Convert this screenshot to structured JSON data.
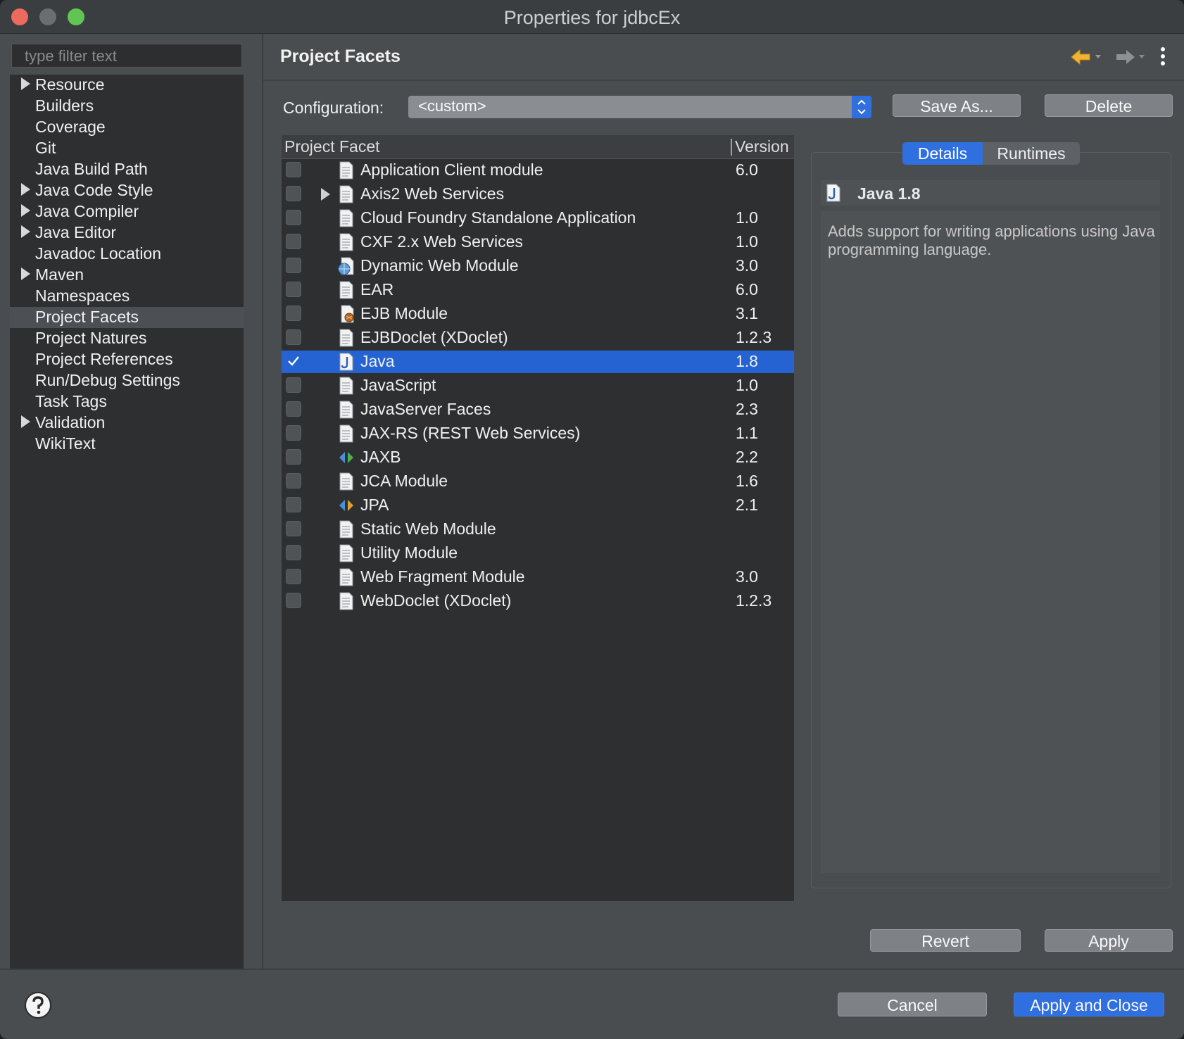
{
  "window": {
    "title": "Properties for jdbcEx"
  },
  "filter": {
    "placeholder": "type filter text"
  },
  "nav": {
    "items": [
      {
        "label": "Resource",
        "expandable": true
      },
      {
        "label": "Builders",
        "expandable": false
      },
      {
        "label": "Coverage",
        "expandable": false
      },
      {
        "label": "Git",
        "expandable": false
      },
      {
        "label": "Java Build Path",
        "expandable": false
      },
      {
        "label": "Java Code Style",
        "expandable": true
      },
      {
        "label": "Java Compiler",
        "expandable": true
      },
      {
        "label": "Java Editor",
        "expandable": true
      },
      {
        "label": "Javadoc Location",
        "expandable": false
      },
      {
        "label": "Maven",
        "expandable": true
      },
      {
        "label": "Namespaces",
        "expandable": false
      },
      {
        "label": "Project Facets",
        "expandable": false,
        "selected": true
      },
      {
        "label": "Project Natures",
        "expandable": false
      },
      {
        "label": "Project References",
        "expandable": false
      },
      {
        "label": "Run/Debug Settings",
        "expandable": false
      },
      {
        "label": "Task Tags",
        "expandable": false
      },
      {
        "label": "Validation",
        "expandable": true
      },
      {
        "label": "WikiText",
        "expandable": false
      }
    ]
  },
  "page": {
    "title": "Project Facets"
  },
  "config": {
    "label": "Configuration:",
    "value": "<custom>",
    "save_as": "Save As...",
    "delete": "Delete"
  },
  "facets": {
    "col_facet": "Project Facet",
    "col_version": "Version",
    "rows": [
      {
        "name": "Application Client module",
        "version": "6.0",
        "checked": false,
        "icon": "document-icon"
      },
      {
        "name": "Axis2 Web Services",
        "version": "",
        "checked": false,
        "icon": "document-icon",
        "expandable": true
      },
      {
        "name": "Cloud Foundry Standalone Application",
        "version": "1.0",
        "checked": false,
        "icon": "document-icon"
      },
      {
        "name": "CXF 2.x Web Services",
        "version": "1.0",
        "checked": false,
        "icon": "document-icon"
      },
      {
        "name": "Dynamic Web Module",
        "version": "3.0",
        "checked": false,
        "icon": "web-module-icon"
      },
      {
        "name": "EAR",
        "version": "6.0",
        "checked": false,
        "icon": "document-icon"
      },
      {
        "name": "EJB Module",
        "version": "3.1",
        "checked": false,
        "icon": "ejb-icon"
      },
      {
        "name": "EJBDoclet (XDoclet)",
        "version": "1.2.3",
        "checked": false,
        "icon": "document-icon"
      },
      {
        "name": "Java",
        "version": "1.8",
        "checked": true,
        "selected": true,
        "icon": "java-icon"
      },
      {
        "name": "JavaScript",
        "version": "1.0",
        "checked": false,
        "icon": "document-icon"
      },
      {
        "name": "JavaServer Faces",
        "version": "2.3",
        "checked": false,
        "icon": "document-icon"
      },
      {
        "name": "JAX-RS (REST Web Services)",
        "version": "1.1",
        "checked": false,
        "icon": "document-icon"
      },
      {
        "name": "JAXB",
        "version": "2.2",
        "checked": false,
        "icon": "jaxb-icon"
      },
      {
        "name": "JCA Module",
        "version": "1.6",
        "checked": false,
        "icon": "document-icon"
      },
      {
        "name": "JPA",
        "version": "2.1",
        "checked": false,
        "icon": "jpa-icon"
      },
      {
        "name": "Static Web Module",
        "version": "",
        "checked": false,
        "icon": "document-icon"
      },
      {
        "name": "Utility Module",
        "version": "",
        "checked": false,
        "icon": "document-icon"
      },
      {
        "name": "Web Fragment Module",
        "version": "3.0",
        "checked": false,
        "icon": "document-icon"
      },
      {
        "name": "WebDoclet (XDoclet)",
        "version": "1.2.3",
        "checked": false,
        "icon": "document-icon"
      }
    ]
  },
  "details": {
    "tab_details": "Details",
    "tab_runtimes": "Runtimes",
    "title": "Java 1.8",
    "description": "Adds support for writing applications using Java programming language."
  },
  "buttons": {
    "revert": "Revert",
    "apply": "Apply",
    "cancel": "Cancel",
    "apply_close": "Apply and Close"
  },
  "colors": {
    "accent": "#2f6fe0",
    "selection": "#2463d1"
  }
}
